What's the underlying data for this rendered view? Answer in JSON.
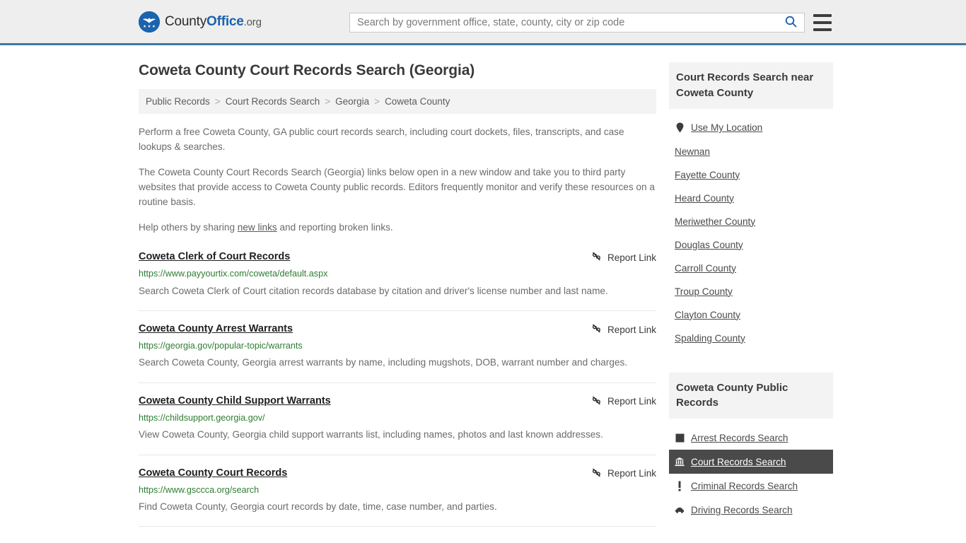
{
  "header": {
    "logo": {
      "part1": "County",
      "part2": "Office",
      "part3": ".org"
    },
    "search": {
      "placeholder": "Search by government office, state, county, city or zip code",
      "value": ""
    },
    "accent_color": "#3b78a8",
    "background_color": "#eeeeee"
  },
  "page_title": "Coweta County Court Records Search (Georgia)",
  "breadcrumb": [
    "Public Records",
    "Court Records Search",
    "Georgia",
    "Coweta County"
  ],
  "breadcrumb_separator": ">",
  "intro": {
    "p1": "Perform a free Coweta County, GA public court records search, including court dockets, files, transcripts, and case lookups & searches.",
    "p2": "The Coweta County Court Records Search (Georgia) links below open in a new window and take you to third party websites that provide access to Coweta County public records. Editors frequently monitor and verify these resources on a routine basis.",
    "p3_before": "Help others by sharing ",
    "p3_link": "new links",
    "p3_after": " and reporting broken links."
  },
  "report_link_label": "Report Link",
  "results": [
    {
      "title": "Coweta Clerk of Court Records",
      "url": "https://www.payyourtix.com/coweta/default.aspx",
      "description": "Search Coweta Clerk of Court citation records database by citation and driver's license number and last name."
    },
    {
      "title": "Coweta County Arrest Warrants",
      "url": "https://georgia.gov/popular-topic/warrants",
      "description": "Search Coweta County, Georgia arrest warrants by name, including mugshots, DOB, warrant number and charges."
    },
    {
      "title": "Coweta County Child Support Warrants",
      "url": "https://childsupport.georgia.gov/",
      "description": "View Coweta County, Georgia child support warrants list, including names, photos and last known addresses."
    },
    {
      "title": "Coweta County Court Records",
      "url": "https://www.gsccca.org/search",
      "description": "Find Coweta County, Georgia court records by date, time, case number, and parties."
    }
  ],
  "sidebar": {
    "nearby": {
      "heading": "Court Records Search near Coweta County",
      "items": [
        {
          "label": "Use My Location",
          "icon": "map-pin-icon"
        },
        {
          "label": "Newnan",
          "icon": ""
        },
        {
          "label": "Fayette County",
          "icon": ""
        },
        {
          "label": "Heard County",
          "icon": ""
        },
        {
          "label": "Meriwether County",
          "icon": ""
        },
        {
          "label": "Douglas County",
          "icon": ""
        },
        {
          "label": "Carroll County",
          "icon": ""
        },
        {
          "label": "Troup County",
          "icon": ""
        },
        {
          "label": "Clayton County",
          "icon": ""
        },
        {
          "label": "Spalding County",
          "icon": ""
        }
      ]
    },
    "public_records": {
      "heading": "Coweta County Public Records",
      "items": [
        {
          "label": "Arrest Records Search",
          "icon": "square-icon",
          "active": false
        },
        {
          "label": "Court Records Search",
          "icon": "courthouse-icon",
          "active": true
        },
        {
          "label": "Criminal Records Search",
          "icon": "exclamation-icon",
          "active": false
        },
        {
          "label": "Driving Records Search",
          "icon": "car-icon",
          "active": false
        }
      ],
      "active_background_color": "#4a4a4a"
    }
  }
}
